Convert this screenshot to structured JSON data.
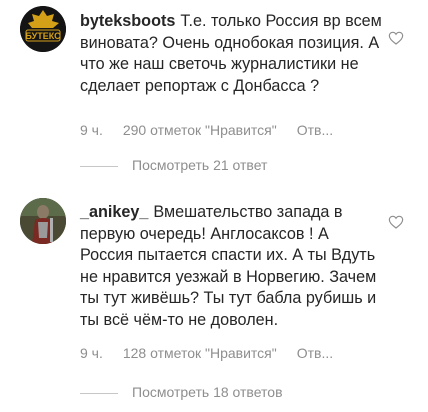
{
  "comments": [
    {
      "username": "byteksboots",
      "text": "Т.е. только Россия вр всем виновата?  Очень однобокая позиция.  А что же наш светочь журналистики не сделает репортаж с Донбасса ?",
      "time": "9 ч.",
      "likes": "290 отметок \"Нравится\"",
      "reply": "Отв...",
      "view_replies": "Посмотреть 21 ответ",
      "avatar_text": "БУТЕКС",
      "avatar_icon": "byteks-logo-icon"
    },
    {
      "username": "_anikey_",
      "text": "Вмешательство запада в первую очередь! Англосаксов ! А Россия пытается спасти их. А ты Вдуть не нравится уезжай в Норвегию. Зачем ты тут живёшь? Ты тут бабла рубишь и ты всё чём-то не доволен.",
      "time": "9 ч.",
      "likes": "128 отметок \"Нравится\"",
      "reply": "Отв...",
      "view_replies": "Посмотреть 18 ответов",
      "avatar_icon": "knight-avatar-icon"
    }
  ],
  "colors": {
    "text": "#262626",
    "secondary": "#8e8e8e",
    "avatar_bg": "#1a1a1a",
    "logo_gold": "#d4a017"
  },
  "icons": [
    "heart-icon"
  ]
}
